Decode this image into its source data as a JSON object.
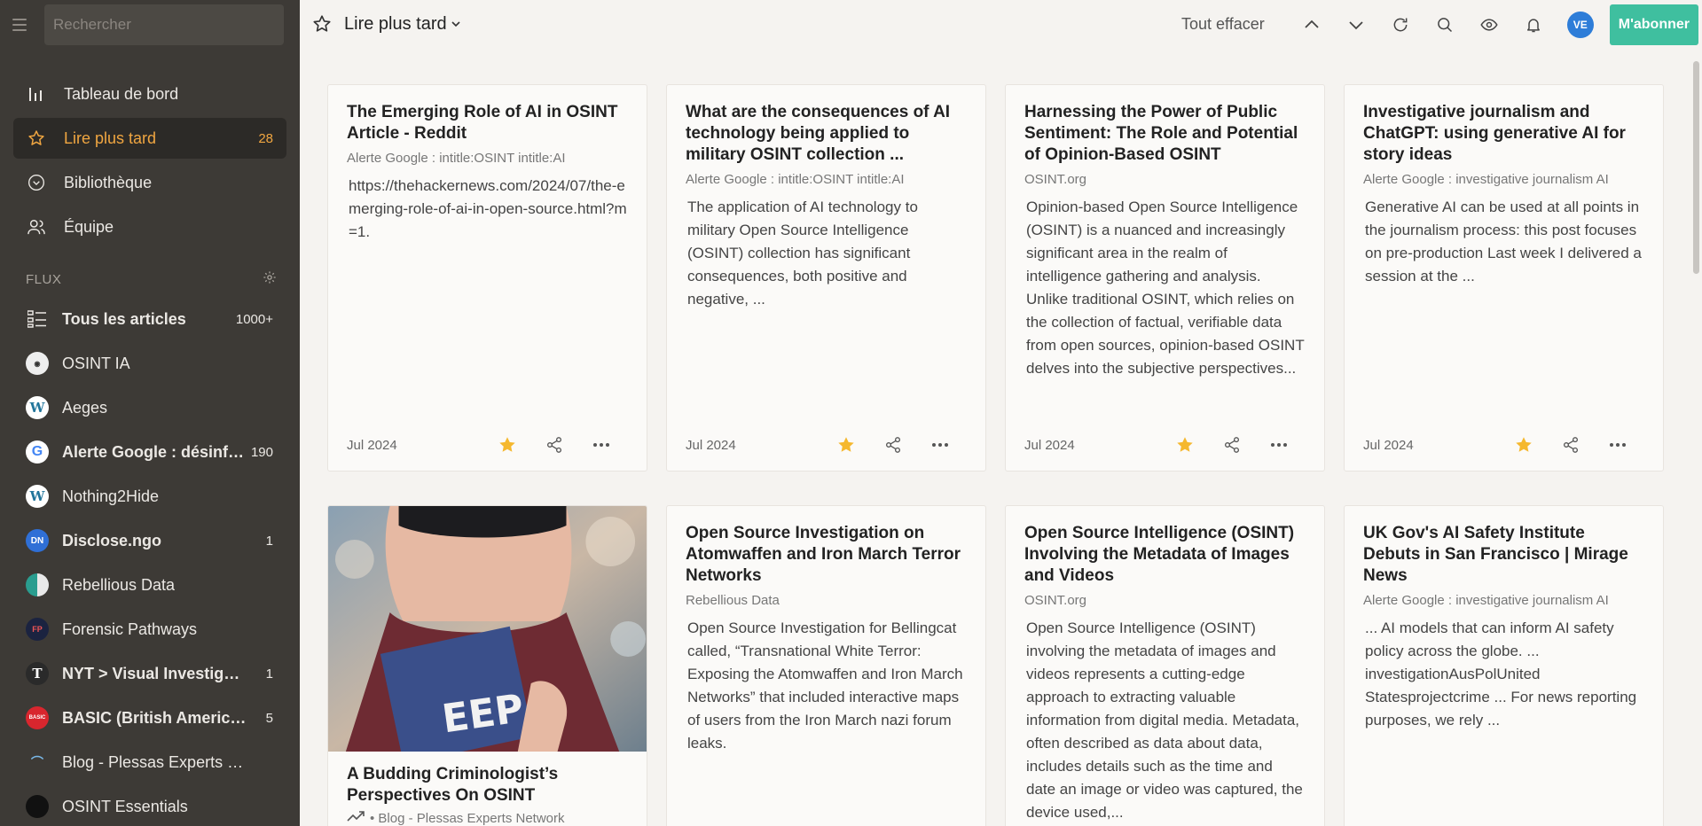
{
  "sidebar": {
    "search_placeholder": "Rechercher",
    "nav": [
      {
        "label": "Tableau de bord",
        "icon": "bar-chart-icon",
        "count": ""
      },
      {
        "label": "Lire plus tard",
        "icon": "star-icon",
        "count": "28"
      },
      {
        "label": "Bibliothèque",
        "icon": "chevron-circle-icon",
        "count": ""
      },
      {
        "label": "Équipe",
        "icon": "team-icon",
        "count": ""
      }
    ],
    "flux_title": "FLUX",
    "feeds": [
      {
        "label": "Tous les articles",
        "count": "1000+",
        "bold": true
      },
      {
        "label": "OSINT IA",
        "count": ""
      },
      {
        "label": "Aeges",
        "count": ""
      },
      {
        "label": "Alerte Google : désinfor...",
        "count": "190",
        "bold": true
      },
      {
        "label": "Nothing2Hide",
        "count": ""
      },
      {
        "label": "Disclose.ngo",
        "count": "1",
        "bold": true,
        "badge": "DN"
      },
      {
        "label": "Rebellious Data",
        "count": ""
      },
      {
        "label": "Forensic Pathways",
        "count": ""
      },
      {
        "label": "NYT > Visual Investigati...",
        "count": "1",
        "bold": true
      },
      {
        "label": "BASIC (British American...",
        "count": "5",
        "bold": true
      },
      {
        "label": "Blog - Plessas Experts N...",
        "count": ""
      },
      {
        "label": "OSINT Essentials",
        "count": ""
      }
    ]
  },
  "topbar": {
    "title": "Lire plus tard",
    "clear_all": "Tout effacer",
    "avatar": "VE",
    "subscribe": "M'abonner"
  },
  "cards": [
    {
      "title": "The Emerging Role of AI in OSINT Article - Reddit",
      "source": "Alerte Google : intitle:OSINT intitle:AI",
      "body": "https://thehackernews.com/2024/07/the-emerging-role-of-ai-in-open-source.html?m=1.",
      "date": "Jul 2024"
    },
    {
      "title": "What are the consequences of AI technology being applied to military OSINT collection ...",
      "source": "Alerte Google : intitle:OSINT intitle:AI",
      "body": "The application of AI technology to military Open Source Intelligence (OSINT) collection has significant consequences, both positive and negative, ...",
      "date": "Jul 2024"
    },
    {
      "title": "Harnessing the Power of Public Sentiment: The Role and Potential of Opinion-Based OSINT",
      "source": "OSINT.org",
      "body": "Opinion-based Open Source Intelligence (OSINT) is a nuanced and increasingly significant area in the realm of intelligence gathering and analysis. Unlike traditional OSINT, which relies on the collection of factual, verifiable data from open sources, opinion-based OSINT delves into the subjective perspectives...",
      "date": "Jul 2024"
    },
    {
      "title": "Investigative journalism and ChatGPT: using generative AI for story ideas",
      "source": "Alerte Google : investigative journalism AI",
      "body": "Generative AI can be used at all points in the journalism process: this post focuses on pre-production Last week I delivered a session at the ...",
      "date": "Jul 2024"
    },
    {
      "title": "A Budding Criminologist’s Perspectives On OSINT",
      "source": "• Blog - Plessas Experts Network",
      "body": "",
      "date": ""
    },
    {
      "title": "Open Source Investigation on Atomwaffen and Iron March Terror Networks",
      "source": "Rebellious Data",
      "body": "Open Source Investigation for Bellingcat called, “Transnational White Terror: Exposing the Atomwaffen and Iron March Networks” that included interactive maps of users from the Iron March nazi forum leaks.",
      "date": ""
    },
    {
      "title": "Open Source Intelligence (OSINT) Involving the Metadata of Images and Videos",
      "source": "OSINT.org",
      "body": "Open Source Intelligence (OSINT) involving the metadata of images and videos represents a cutting-edge approach to extracting valuable information from digital media. Metadata, often described as data about data, includes details such as the time and date an image or video was captured, the device used,...",
      "date": ""
    },
    {
      "title": "UK Gov's AI Safety Institute Debuts in San Francisco | Mirage News",
      "source": "Alerte Google : investigative journalism AI",
      "body": "... AI models that can inform AI safety policy across the globe. ... investigationAusPolUnited Statesprojectcrime ... For news reporting purposes, we rely ...",
      "date": ""
    }
  ],
  "colors": {
    "sidebar_bg": "#3d3a36",
    "accent": "#f0a641",
    "subscribe": "#3fbf9f",
    "star": "#f5b82e"
  }
}
